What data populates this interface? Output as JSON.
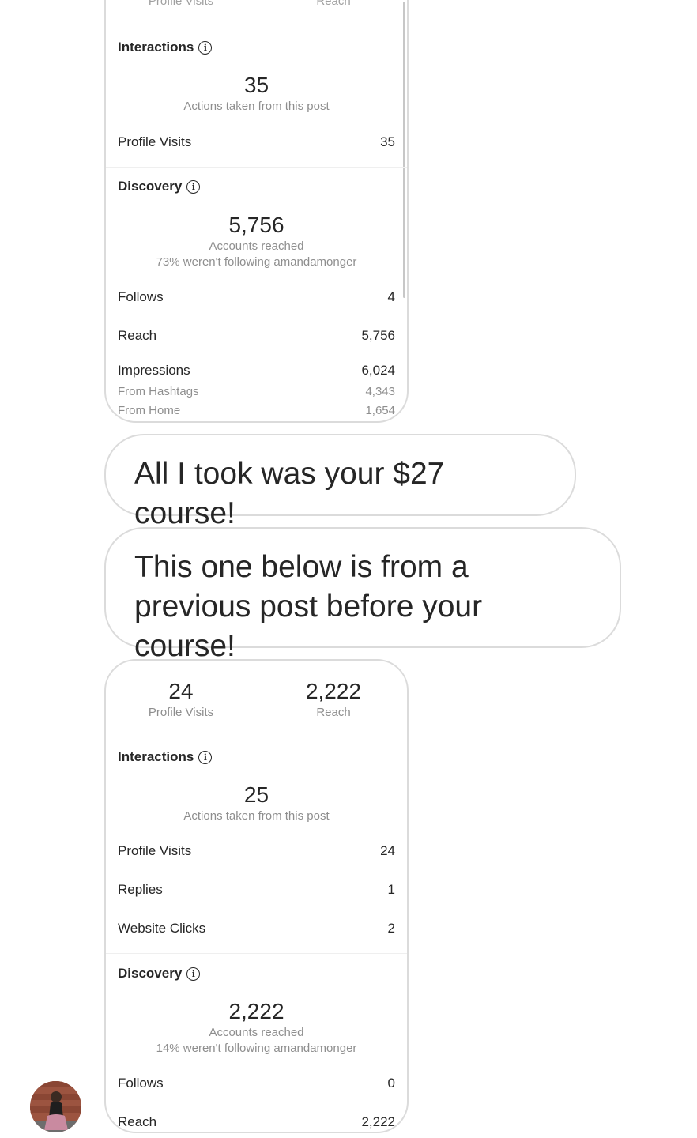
{
  "card1": {
    "top_metrics": [
      {
        "label": "Profile Visits"
      },
      {
        "label": "Reach"
      }
    ],
    "interactions": {
      "title": "Interactions",
      "total": "35",
      "total_label": "Actions taken from this post",
      "rows": [
        {
          "label": "Profile Visits",
          "value": "35"
        }
      ]
    },
    "discovery": {
      "title": "Discovery",
      "total": "5,756",
      "total_label": "Accounts reached",
      "note": "73% weren't following amandamonger",
      "rows": [
        {
          "label": "Follows",
          "value": "4"
        },
        {
          "label": "Reach",
          "value": "5,756"
        },
        {
          "label": "Impressions",
          "value": "6,024"
        }
      ],
      "sub_rows": [
        {
          "label": "From Hashtags",
          "value": "4,343"
        },
        {
          "label": "From Home",
          "value": "1,654"
        }
      ]
    }
  },
  "messages": [
    {
      "text": "All I took was your $27 course!"
    },
    {
      "text": "This one below is from a previous post before your course!"
    }
  ],
  "card2": {
    "top_metrics": [
      {
        "value": "24",
        "label": "Profile Visits"
      },
      {
        "value": "2,222",
        "label": "Reach"
      }
    ],
    "interactions": {
      "title": "Interactions",
      "total": "25",
      "total_label": "Actions taken from this post",
      "rows": [
        {
          "label": "Profile Visits",
          "value": "24"
        },
        {
          "label": "Replies",
          "value": "1"
        },
        {
          "label": "Website Clicks",
          "value": "2"
        }
      ]
    },
    "discovery": {
      "title": "Discovery",
      "total": "2,222",
      "total_label": "Accounts reached",
      "note": "14% weren't following amandamonger",
      "rows": [
        {
          "label": "Follows",
          "value": "0"
        },
        {
          "label": "Reach",
          "value": "2,222"
        }
      ]
    }
  },
  "info_icon_glyph": "i",
  "avatar_icon": "user-avatar"
}
